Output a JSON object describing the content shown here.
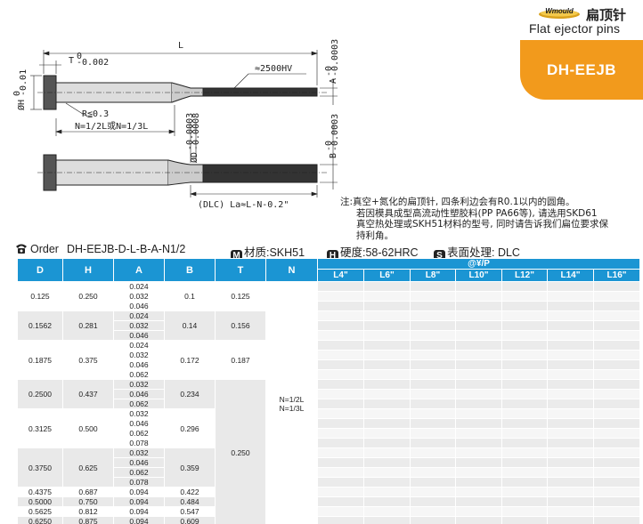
{
  "header": {
    "brand": "Wmould",
    "title_cn": "扁顶针",
    "title_en": "Flat ejector pins",
    "code": "DH-EEJB"
  },
  "drawing": {
    "L": "L",
    "T_tol": "T",
    "T_sup": "0",
    "T_sub": "-0.002",
    "H": "ØH",
    "H_sup": "0",
    "H_sub": "-0.01",
    "R": "R≦0.3",
    "N": "N=1/2L或N=1/3L",
    "hv": "≈2500HV",
    "A": "A",
    "A_sup": "-0",
    "A_sub": "-0.0003",
    "B": "B",
    "B_sup": "-0",
    "B_sub": "-0.0003",
    "D": "ØD",
    "D_sup": "-0.0003",
    "D_sub": "-0.0008",
    "La": "(DLC) La≈L-N-0.2\""
  },
  "note": {
    "lines": [
      "注:真空+氮化的扁顶针, 四条利边会有R0.1以内的圆角。",
      "若因模具成型高流动性塑胶料(PP PA66等), 请选用SKD61",
      "真空热处理或SKH51材料的型号, 同时请告诉我们扁位要求保",
      "持利角。"
    ]
  },
  "order": {
    "label": "Order",
    "code": "DH-EEJB-D-L-B-A-N1/2",
    "material_icon": "M",
    "material": "材质:SKH51",
    "hardness_icon": "H",
    "hardness": "硬度:58-62HRC",
    "surface_icon": "S",
    "surface": "表面处理: DLC"
  },
  "table": {
    "headers": [
      "D",
      "H",
      "A",
      "B",
      "T",
      "N"
    ],
    "price_header": "@¥/P",
    "lengths": [
      "L4\"",
      "L6\"",
      "L8\"",
      "L10\"",
      "L12\"",
      "L14\"",
      "L16\""
    ],
    "groups": [
      {
        "D": "0.125",
        "H": "0.250",
        "A": [
          "0.024",
          "0.032",
          "0.046"
        ],
        "B": "0.1",
        "T": "0.125"
      },
      {
        "D": "0.1562",
        "H": "0.281",
        "A": [
          "0.024",
          "0.032",
          "0.046"
        ],
        "B": "0.14",
        "T": "0.156"
      },
      {
        "D": "0.1875",
        "H": "0.375",
        "A": [
          "0.024",
          "0.032",
          "0.046",
          "0.062"
        ],
        "B": "0.172",
        "T": "0.187"
      },
      {
        "D": "0.2500",
        "H": "0.437",
        "A": [
          "0.032",
          "0.046",
          "0.062"
        ],
        "B": "0.234",
        "T": ""
      },
      {
        "D": "0.3125",
        "H": "0.500",
        "A": [
          "0.032",
          "0.046",
          "0.062",
          "0.078"
        ],
        "B": "0.296",
        "T": ""
      },
      {
        "D": "0.3750",
        "H": "0.625",
        "A": [
          "0.032",
          "0.046",
          "0.062",
          "0.078"
        ],
        "B": "0.359",
        "T": ""
      },
      {
        "D": "0.4375",
        "H": "0.687",
        "A": [
          "0.094"
        ],
        "B": "0.422",
        "T": ""
      },
      {
        "D": "0.5000",
        "H": "0.750",
        "A": [
          "0.094"
        ],
        "B": "0.484",
        "T": ""
      },
      {
        "D": "0.5625",
        "H": "0.812",
        "A": [
          "0.094"
        ],
        "B": "0.547",
        "T": ""
      },
      {
        "D": "0.6250",
        "H": "0.875",
        "A": [
          "0.094"
        ],
        "B": "0.609",
        "T": ""
      }
    ],
    "T_merged": "0.250",
    "N_value_1": "N=1/2L",
    "N_value_2": "N=1/3L"
  },
  "colors": {
    "accent": "#f29a1c",
    "table_header": "#1b95d3",
    "row_grey": "#e9e9e9"
  }
}
